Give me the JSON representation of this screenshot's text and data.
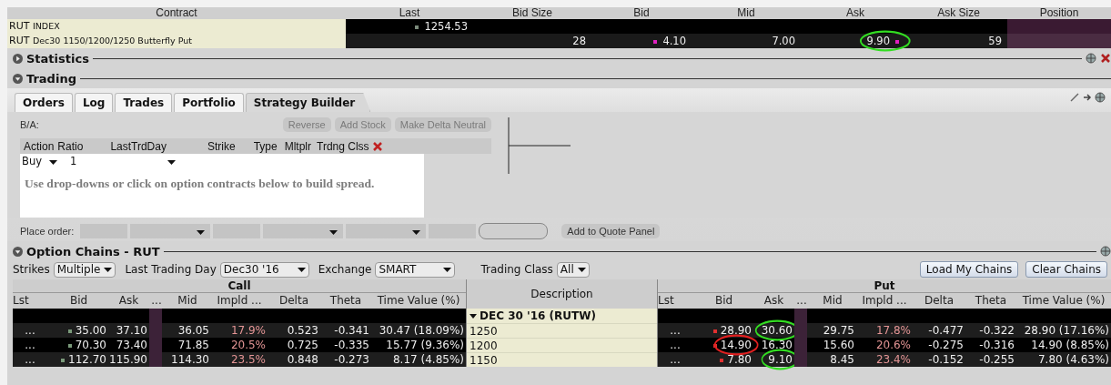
{
  "quote_table": {
    "columns": [
      "Contract",
      "Last",
      "Bid Size",
      "Bid",
      "Mid",
      "Ask",
      "Ask Size",
      "Position"
    ],
    "rows": [
      {
        "symbol": "RUT",
        "detail": "INDEX",
        "last": "1254.53"
      },
      {
        "symbol": "RUT",
        "detail": "Dec30 1150/1200/1250 Butterfly Put",
        "bid_size": "28",
        "bid": "4.10",
        "mid": "7.00",
        "ask": "9.90",
        "ask_circle": {
          "color": "#33dd22"
        },
        "ask_size": "59"
      }
    ]
  },
  "statistics": {
    "title": "Statistics",
    "expanded": false
  },
  "trading": {
    "title": "Trading",
    "expanded": true
  },
  "tabs": [
    {
      "label": "Orders",
      "selected": false
    },
    {
      "label": "Log",
      "selected": false
    },
    {
      "label": "Trades",
      "selected": false
    },
    {
      "label": "Portfolio",
      "selected": false
    },
    {
      "label": "Strategy Builder",
      "selected": true
    }
  ],
  "strategy_builder": {
    "ba_label": "B/A:",
    "buttons": [
      {
        "label": "Reverse",
        "disabled": true
      },
      {
        "label": "Add Stock",
        "disabled": true
      },
      {
        "label": "Make Delta Neutral",
        "disabled": true
      }
    ],
    "leg_columns": [
      "Action",
      "Ratio",
      "LastTrdDay",
      "Strike",
      "Type",
      "Mltplr",
      "Trdng Clss"
    ],
    "leg": {
      "action": "Buy",
      "ratio": "1"
    },
    "hint": "Use drop-downs or click on option contracts below to build spread.",
    "place_order_label": "Place order:",
    "order_fields": [
      {
        "kind": "field"
      },
      {
        "kind": "dropdown"
      },
      {
        "kind": "field"
      },
      {
        "kind": "dropdown"
      },
      {
        "kind": "dropdown"
      },
      {
        "kind": "field"
      },
      {
        "kind": "pill"
      }
    ],
    "add_button": {
      "label": "Add to Quote Panel",
      "disabled": false
    }
  },
  "option_chains": {
    "title": "Option Chains - RUT",
    "expanded": true,
    "filters": [
      {
        "label": "Strikes",
        "value": "Multiple"
      },
      {
        "label": "Last Trading Day",
        "value": "Dec30 '16"
      },
      {
        "label": "Exchange",
        "value": "SMART"
      },
      {
        "label": "Trading Class",
        "value": "All"
      }
    ],
    "buttons": [
      "Load My Chains",
      "Clear Chains"
    ],
    "call_title": "Call",
    "put_title": "Put",
    "description_header": "Description",
    "call_columns": [
      "Lst",
      "Bid",
      "Ask",
      "...",
      "Mid",
      "Impld ...",
      "Delta",
      "Theta",
      "Time Value (%)"
    ],
    "put_columns": [
      "Lst",
      "Bid",
      "Ask",
      "...",
      "Mid",
      "Impld ...",
      "Delta",
      "Theta",
      "Time Value (%)"
    ],
    "expiry": "DEC 30 '16 (RUTW)",
    "rows": [
      {
        "strike": "1250",
        "call": [
          "...",
          "35.00",
          "37.10",
          "36.05",
          "17.9%",
          "0.523",
          "-0.341",
          "30.47 (18.09%)"
        ],
        "put": [
          "...",
          "28.90",
          {
            "text": "30.60",
            "circle": {
              "color": "#33dd22"
            }
          },
          "29.75",
          "17.8%",
          "-0.477",
          "-0.322",
          "28.90 (17.16%)"
        ]
      },
      {
        "strike": "1200",
        "call": [
          "...",
          "70.30",
          "73.40",
          "71.85",
          "20.5%",
          "0.725",
          "-0.335",
          "15.77 (9.36%)"
        ],
        "put": [
          "...",
          {
            "text": "14.90",
            "circle": {
              "color": "#e02020"
            }
          },
          "16.30",
          "15.60",
          "20.6%",
          "-0.275",
          "-0.316",
          "14.90 (8.85%)"
        ]
      },
      {
        "strike": "1150",
        "call": [
          "...",
          "112.70",
          "115.90",
          "114.30",
          "23.5%",
          "0.848",
          "-0.273",
          "8.17 (4.85%)"
        ],
        "put": [
          "...",
          "7.80",
          {
            "text": "9.10",
            "circle": {
              "color": "#33dd22"
            }
          },
          "8.45",
          "23.4%",
          "-0.152",
          "-0.255",
          "7.80 (4.63%)"
        ]
      }
    ]
  }
}
